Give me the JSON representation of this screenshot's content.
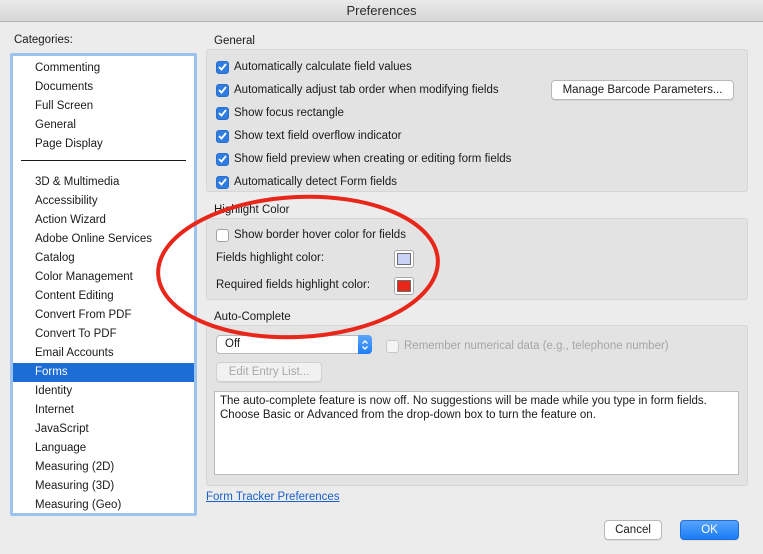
{
  "window": {
    "title": "Preferences"
  },
  "categories": {
    "label": "Categories:",
    "top_items": [
      "Commenting",
      "Documents",
      "Full Screen",
      "General",
      "Page Display"
    ],
    "items": [
      "3D & Multimedia",
      "Accessibility",
      "Action Wizard",
      "Adobe Online Services",
      "Catalog",
      "Color Management",
      "Content Editing",
      "Convert From PDF",
      "Convert To PDF",
      "Email Accounts",
      "Forms",
      "Identity",
      "Internet",
      "JavaScript",
      "Language",
      "Measuring (2D)",
      "Measuring (3D)",
      "Measuring (Geo)"
    ],
    "selected": "Forms"
  },
  "general": {
    "title": "General",
    "options": [
      {
        "label": "Automatically calculate field values",
        "checked": true
      },
      {
        "label": "Automatically adjust tab order when modifying fields",
        "checked": true
      },
      {
        "label": "Show focus rectangle",
        "checked": true
      },
      {
        "label": "Show text field overflow indicator",
        "checked": true
      },
      {
        "label": "Show field preview when creating or editing form fields",
        "checked": true
      },
      {
        "label": "Automatically detect Form fields",
        "checked": true
      }
    ],
    "barcode_button": "Manage Barcode Parameters..."
  },
  "highlight": {
    "title": "Highlight Color",
    "hover_option": {
      "label": "Show border hover color for fields",
      "checked": false
    },
    "fields_label": "Fields highlight color:",
    "fields_color": "#c8d3f5",
    "required_label": "Required fields highlight color:",
    "required_color": "#e8261a"
  },
  "autocomplete": {
    "title": "Auto-Complete",
    "selected_value": "Off",
    "remember_label": "Remember numerical data (e.g., telephone number)",
    "remember_checked": false,
    "edit_button": "Edit Entry List...",
    "description": "The auto-complete feature is now off. No suggestions will be made while you type in form fields. Choose Basic or Advanced from the drop-down box to turn the feature on."
  },
  "footer": {
    "link": "Form Tracker Preferences",
    "cancel": "Cancel",
    "ok": "OK"
  },
  "annotation_color": "#e8261a"
}
